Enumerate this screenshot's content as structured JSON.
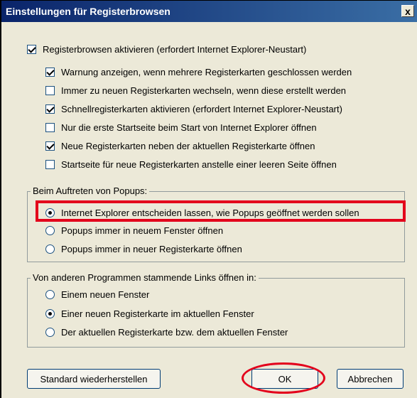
{
  "window": {
    "title": "Einstellungen für Registerbrowsen",
    "close_label": "x"
  },
  "tabbed_browsing": {
    "label": "Registerbrowsen aktivieren (erfordert Internet Explorer-Neustart)",
    "checked": true,
    "options": [
      {
        "label": "Warnung anzeigen, wenn mehrere Registerkarten geschlossen werden",
        "checked": true
      },
      {
        "label": "Immer zu neuen Registerkarten wechseln, wenn diese erstellt werden",
        "checked": false
      },
      {
        "label": "Schnellregisterkarten aktivieren (erfordert Internet Explorer-Neustart)",
        "checked": true
      },
      {
        "label": "Nur die erste Startseite beim Start von Internet Explorer öffnen",
        "checked": false
      },
      {
        "label": "Neue Registerkarten neben der aktuellen Registerkarte öffnen",
        "checked": true
      },
      {
        "label": "Startseite für neue Registerkarten anstelle einer leeren Seite öffnen",
        "checked": false
      }
    ]
  },
  "popups": {
    "title": "Beim Auftreten von Popups:",
    "options": [
      {
        "label": "Internet Explorer entscheiden lassen, wie Popups geöffnet werden sollen",
        "selected": true
      },
      {
        "label": "Popups immer in neuem Fenster öffnen",
        "selected": false
      },
      {
        "label": "Popups immer in neuer Registerkarte öffnen",
        "selected": false
      }
    ]
  },
  "links": {
    "title": "Von anderen Programmen stammende Links öffnen in:",
    "options": [
      {
        "label": "Einem neuen Fenster",
        "selected": false
      },
      {
        "label": "Einer neuen Registerkarte im aktuellen Fenster",
        "selected": true
      },
      {
        "label": "Der aktuellen Registerkarte bzw. dem aktuellen Fenster",
        "selected": false
      }
    ]
  },
  "buttons": {
    "restore": "Standard wiederherstellen",
    "ok": "OK",
    "cancel": "Abbrechen"
  },
  "colors": {
    "titlebar_start": "#0a246a",
    "titlebar_end": "#3a6ea5",
    "dialog_bg": "#ece9d8",
    "annotation_red": "#e3001b"
  }
}
